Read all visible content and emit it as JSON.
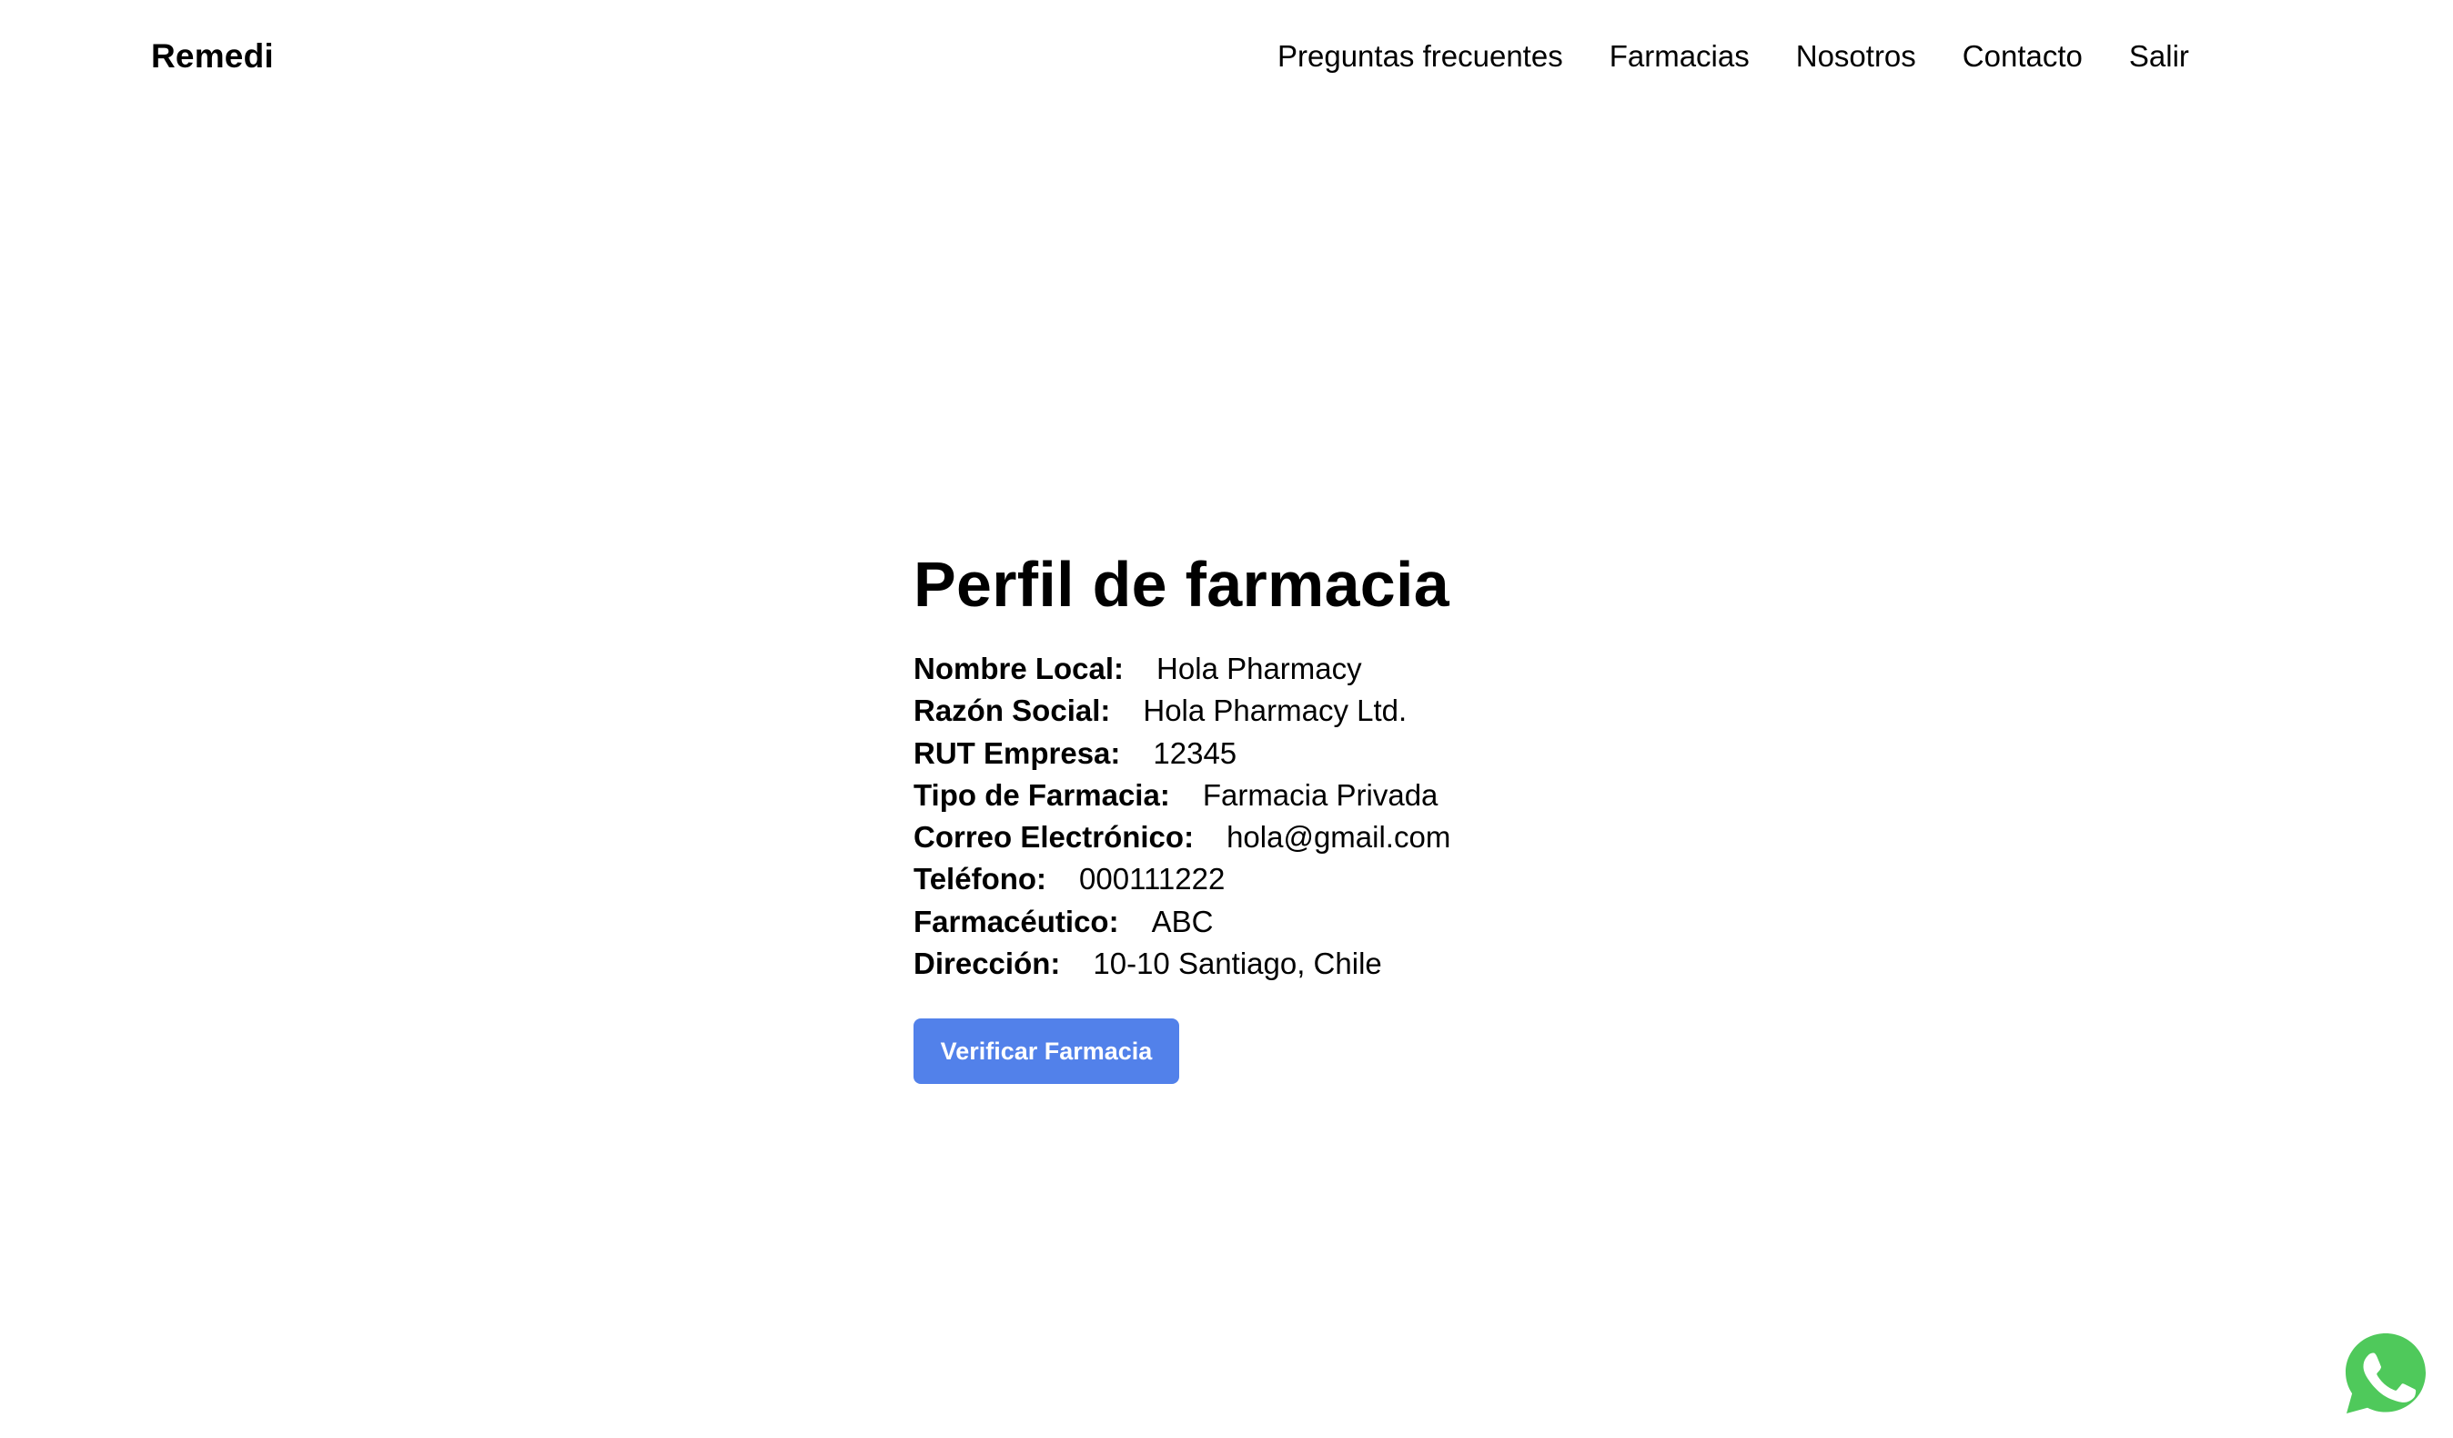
{
  "header": {
    "brand": "Remedi",
    "nav": [
      {
        "label": "Preguntas frecuentes"
      },
      {
        "label": "Farmacias"
      },
      {
        "label": "Nosotros"
      },
      {
        "label": "Contacto"
      },
      {
        "label": "Salir"
      }
    ]
  },
  "profile": {
    "title": "Perfil de farmacia",
    "fields": [
      {
        "label": "Nombre Local:",
        "value": "Hola Pharmacy"
      },
      {
        "label": "Razón Social:",
        "value": "Hola Pharmacy Ltd."
      },
      {
        "label": "RUT Empresa:",
        "value": "12345"
      },
      {
        "label": "Tipo de Farmacia:",
        "value": "Farmacia Privada"
      },
      {
        "label": "Correo Electrónico:",
        "value": "hola@gmail.com"
      },
      {
        "label": "Teléfono:",
        "value": "000111222"
      },
      {
        "label": "Farmacéutico:",
        "value": "ABC"
      },
      {
        "label": "Dirección:",
        "value": "10-10 Santiago, Chile"
      }
    ],
    "verify_button": "Verificar Farmacia"
  },
  "colors": {
    "accent": "#5281ea",
    "whatsapp_green": "#4fc95b"
  },
  "icons": {
    "chat_widget": "whatsapp-icon"
  }
}
